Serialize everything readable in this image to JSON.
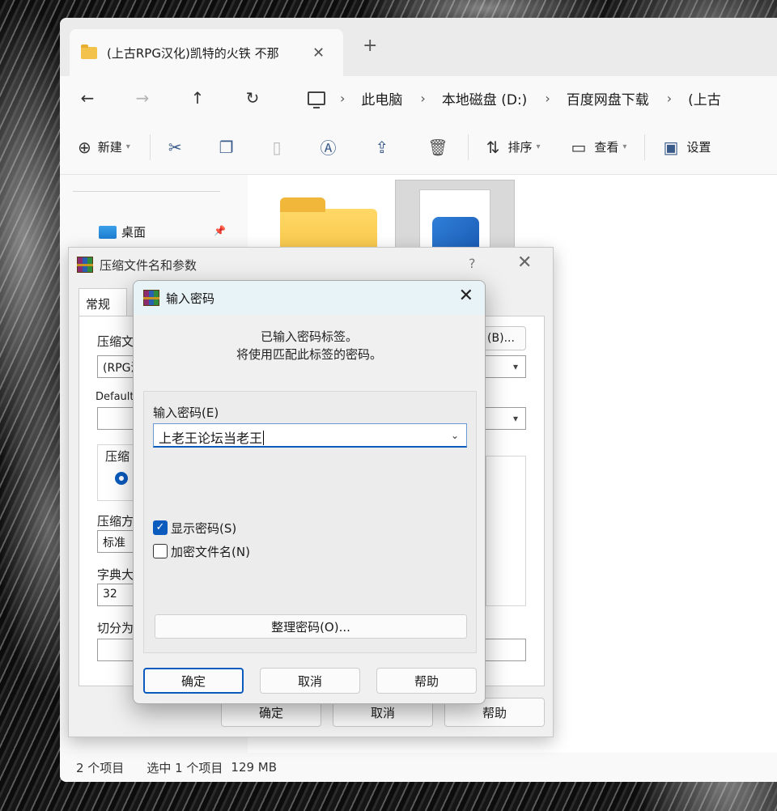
{
  "explorer": {
    "tab_title": "(上古RPG汉化)凯特的火铁 不那",
    "tab_close": "✕",
    "new_tab": "+",
    "nav": {
      "back": "←",
      "forward": "→",
      "up": "↑",
      "refresh": "↻"
    },
    "breadcrumbs": [
      "此电脑",
      "本地磁盘 (D:)",
      "百度网盘下载",
      "(上古"
    ],
    "breadcrumb_sep": "›",
    "toolbar": {
      "new_label": "新建",
      "sort_label": "排序",
      "view_label": "查看",
      "settings_label": "设置"
    },
    "sidebar": {
      "desktop_label": "桌面"
    },
    "status": {
      "count": "2 个项目",
      "selection": "选中 1 个项目",
      "size": "129 MB"
    }
  },
  "archive_dialog": {
    "title": "压缩文件名和参数",
    "help": "?",
    "close": "✕",
    "tab_general": "常规",
    "label_archive_name": "压缩文",
    "field_archive_name": "(RPG汉",
    "label_default": "Default",
    "label_format_group": "压缩",
    "label_method": "压缩方",
    "field_method": "标准",
    "label_dict": "字典大",
    "field_dict": "32",
    "label_split": "切分为",
    "browse_button": "(B)...",
    "paren_fragment": ")",
    "ok": "确定",
    "cancel": "取消",
    "help_button": "帮助"
  },
  "password_dialog": {
    "title": "输入密码",
    "close": "✕",
    "message_line1": "已输入密码标签。",
    "message_line2": "将使用匹配此标签的密码。",
    "password_label": "输入密码(E)",
    "password_value": "上老王论坛当老王",
    "show_password_label": "显示密码(S)",
    "show_password_checked": true,
    "encrypt_names_label": "加密文件名(N)",
    "encrypt_names_checked": false,
    "organize_button": "整理密码(O)...",
    "ok": "确定",
    "cancel": "取消",
    "help": "帮助"
  },
  "colors": {
    "accent": "#0a5bbd",
    "titlebar": "#e8f3f7",
    "folder": "#f5c13d"
  }
}
